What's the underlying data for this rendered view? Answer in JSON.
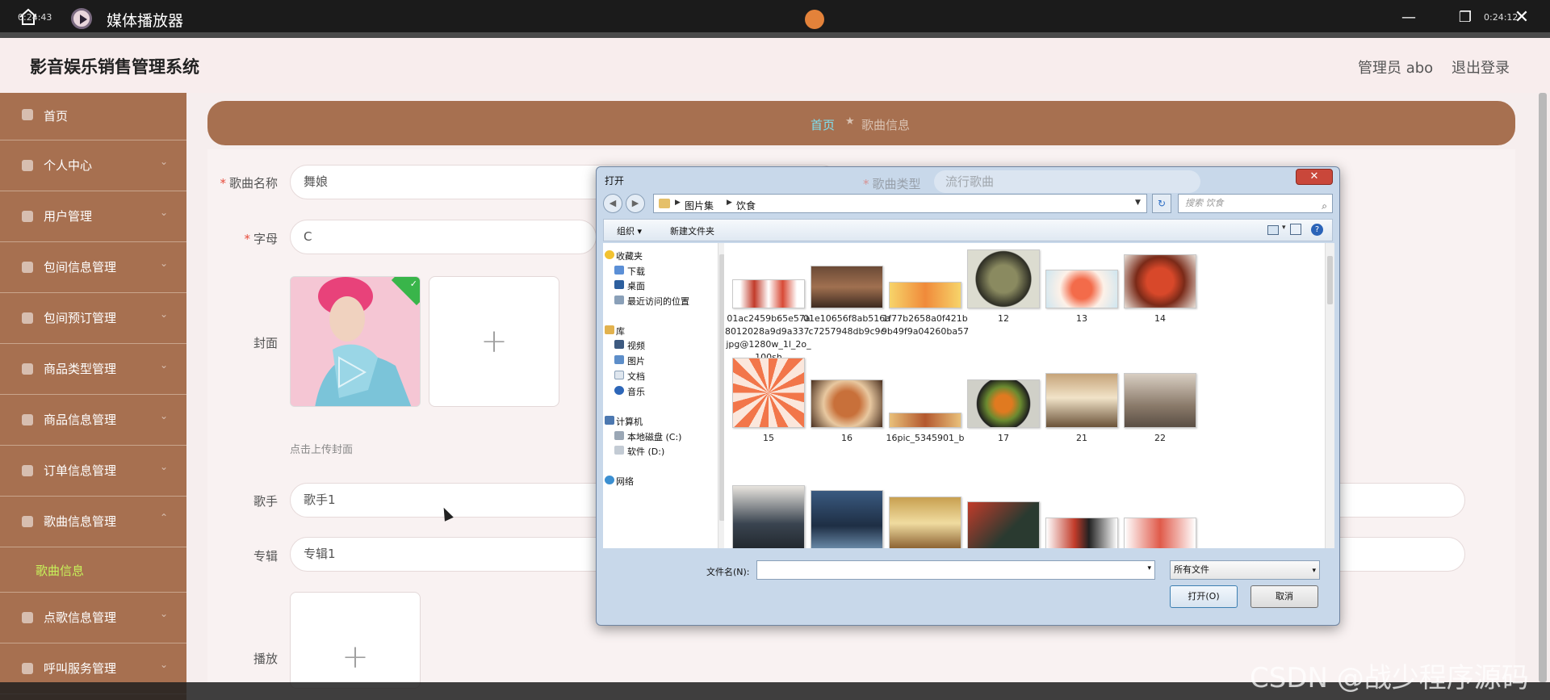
{
  "player": {
    "title": "媒体播放器",
    "time_current": "0:24:43",
    "time_total": "0:24:12"
  },
  "app": {
    "title": "影音娱乐销售管理系统",
    "admin": "管理员 abo",
    "logout": "退出登录"
  },
  "sidebar": {
    "items": [
      {
        "label": "首页"
      },
      {
        "label": "个人中心"
      },
      {
        "label": "用户管理"
      },
      {
        "label": "包间信息管理"
      },
      {
        "label": "包间预订管理"
      },
      {
        "label": "商品类型管理"
      },
      {
        "label": "商品信息管理"
      },
      {
        "label": "订单信息管理"
      },
      {
        "label": "歌曲信息管理"
      },
      {
        "label": "点歌信息管理"
      },
      {
        "label": "呼叫服务管理"
      }
    ],
    "active_sub": "歌曲信息"
  },
  "breadcrumb": {
    "home": "首页",
    "current": "歌曲信息"
  },
  "form": {
    "song_name_label": "歌曲名称",
    "song_name_value": "舞娘",
    "song_type_label": "歌曲类型",
    "song_type_value": "流行歌曲",
    "letter_label": "字母",
    "letter_value": "C",
    "cover_label": "封面",
    "cover_tip": "点击上传封面",
    "singer_label": "歌手",
    "singer_value": "歌手1",
    "album_label": "专辑",
    "album_value": "专辑1",
    "play_label": "播放"
  },
  "dialog": {
    "title": "打开",
    "path": [
      "图片集",
      "饮食"
    ],
    "search_placeholder": "搜索 饮食",
    "organize": "组织 ▾",
    "new_folder": "新建文件夹",
    "nav": {
      "favorites": "收藏夹",
      "downloads": "下载",
      "desktop": "桌面",
      "recent": "最近访问的位置",
      "libraries": "库",
      "videos": "视频",
      "pictures": "图片",
      "documents": "文档",
      "music": "音乐",
      "computer": "计算机",
      "disk_c": "本地磁盘 (C:)",
      "disk_d": "软件 (D:)",
      "network": "网络"
    },
    "files": [
      {
        "name": "01ac2459b65e57a8012028a9d9a337.jpg@1280w_1l_2o_100sh"
      },
      {
        "name": "01e10656f8ab516ac7257948db9c9c"
      },
      {
        "name": "1f77b2658a0f421b9b49f9a04260ba57"
      },
      {
        "name": "12"
      },
      {
        "name": "13"
      },
      {
        "name": "14"
      },
      {
        "name": "15"
      },
      {
        "name": "16"
      },
      {
        "name": "16pic_5345901_b"
      },
      {
        "name": "17"
      },
      {
        "name": "21"
      },
      {
        "name": "22"
      }
    ],
    "filename_label": "文件名(N):",
    "filetype": "所有文件",
    "open_button": "打开(O)",
    "cancel_button": "取消"
  },
  "watermark": "CSDN @战少程序源码"
}
